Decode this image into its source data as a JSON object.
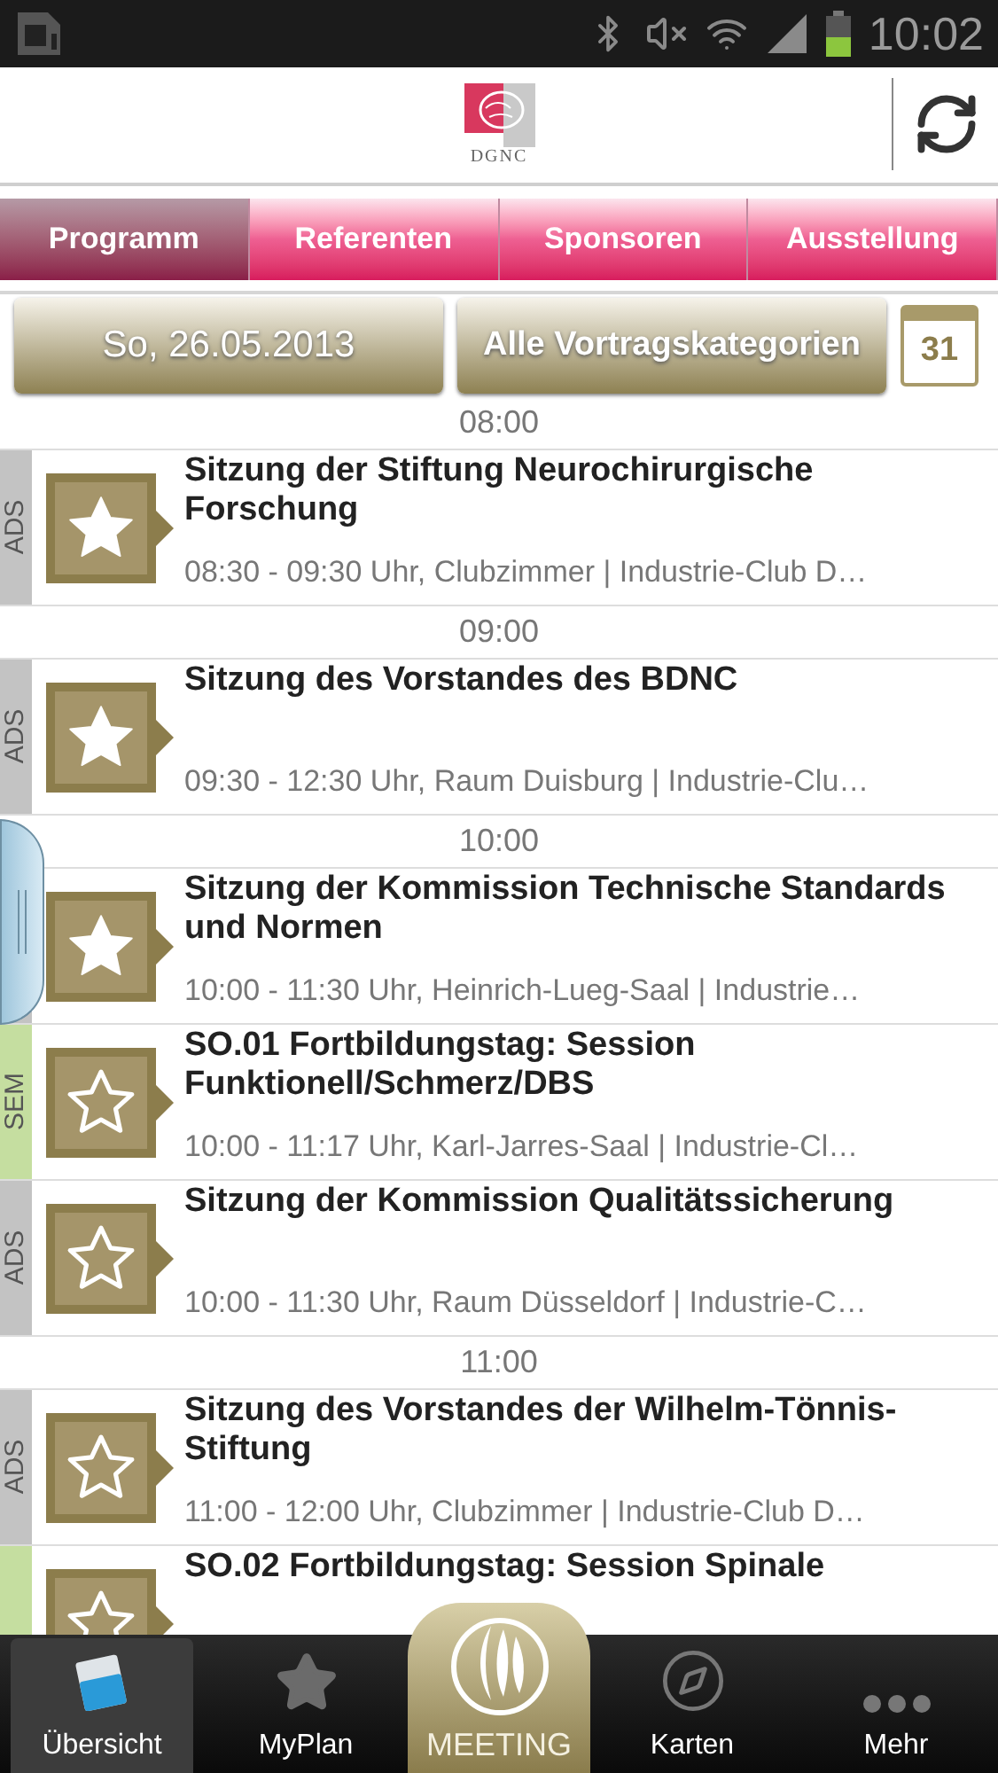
{
  "status_bar": {
    "time": "10:02"
  },
  "header": {
    "logo_text": "DGNC"
  },
  "tabs": [
    {
      "label": "Programm",
      "selected": true
    },
    {
      "label": "Referenten",
      "selected": false
    },
    {
      "label": "Sponsoren",
      "selected": false
    },
    {
      "label": "Ausstellung",
      "selected": false
    }
  ],
  "filters": {
    "date": "So, 26.05.2013",
    "category": "Alle Vortragskategorien",
    "calendar_day": "31"
  },
  "program": [
    {
      "kind": "time",
      "label": "08:00"
    },
    {
      "kind": "session",
      "category": "ADS",
      "color": "#c3c3c3",
      "favorite": true,
      "title": "Sitzung der Stiftung Neurochirurgische Forschung",
      "details": "08:30 - 09:30 Uhr, Clubzimmer | Industrie-Club D…"
    },
    {
      "kind": "time",
      "label": "09:00"
    },
    {
      "kind": "session",
      "category": "ADS",
      "color": "#c3c3c3",
      "favorite": true,
      "title": "Sitzung des Vorstandes des BDNC",
      "details": "09:30 - 12:30 Uhr, Raum Duisburg | Industrie-Clu…"
    },
    {
      "kind": "time",
      "label": "10:00"
    },
    {
      "kind": "session",
      "color": "#c3c3c3",
      "favorite": true,
      "title": "Sitzung der Kommission Technische Standards und Normen",
      "details": "10:00 - 11:30 Uhr, Heinrich-Lueg-Saal | Industrie…"
    },
    {
      "kind": "session",
      "category": "SEM",
      "color": "#c5dea0",
      "favorite": false,
      "title": "SO.01 Fortbildungstag: Session Funktionell/Schmerz/DBS",
      "details": "10:00 - 11:17 Uhr, Karl-Jarres-Saal | Industrie-Cl…"
    },
    {
      "kind": "session",
      "category": "ADS",
      "color": "#c3c3c3",
      "favorite": false,
      "title": "Sitzung der Kommission Qualitätssicherung",
      "details": "10:00 - 11:30 Uhr, Raum Düsseldorf | Industrie-C…"
    },
    {
      "kind": "time",
      "label": "11:00"
    },
    {
      "kind": "session",
      "category": "ADS",
      "color": "#c3c3c3",
      "favorite": false,
      "title": "Sitzung des Vorstandes der  Wilhelm-Tönnis-Stiftung",
      "details": "11:00 - 12:00 Uhr, Clubzimmer | Industrie-Club D…"
    },
    {
      "kind": "session",
      "color": "#c5dea0",
      "favorite": false,
      "title": "SO.02 Fortbildungstag: Session Spinale"
    }
  ],
  "bottom_nav": [
    {
      "label": "Übersicht",
      "kind": "overview",
      "selected": true
    },
    {
      "label": "MyPlan",
      "kind": "myplan",
      "selected": false
    },
    {
      "label": "MEETING",
      "kind": "meeting",
      "selected": false
    },
    {
      "label": "Karten",
      "kind": "maps",
      "selected": false
    },
    {
      "label": "Mehr",
      "kind": "more",
      "selected": false
    }
  ]
}
